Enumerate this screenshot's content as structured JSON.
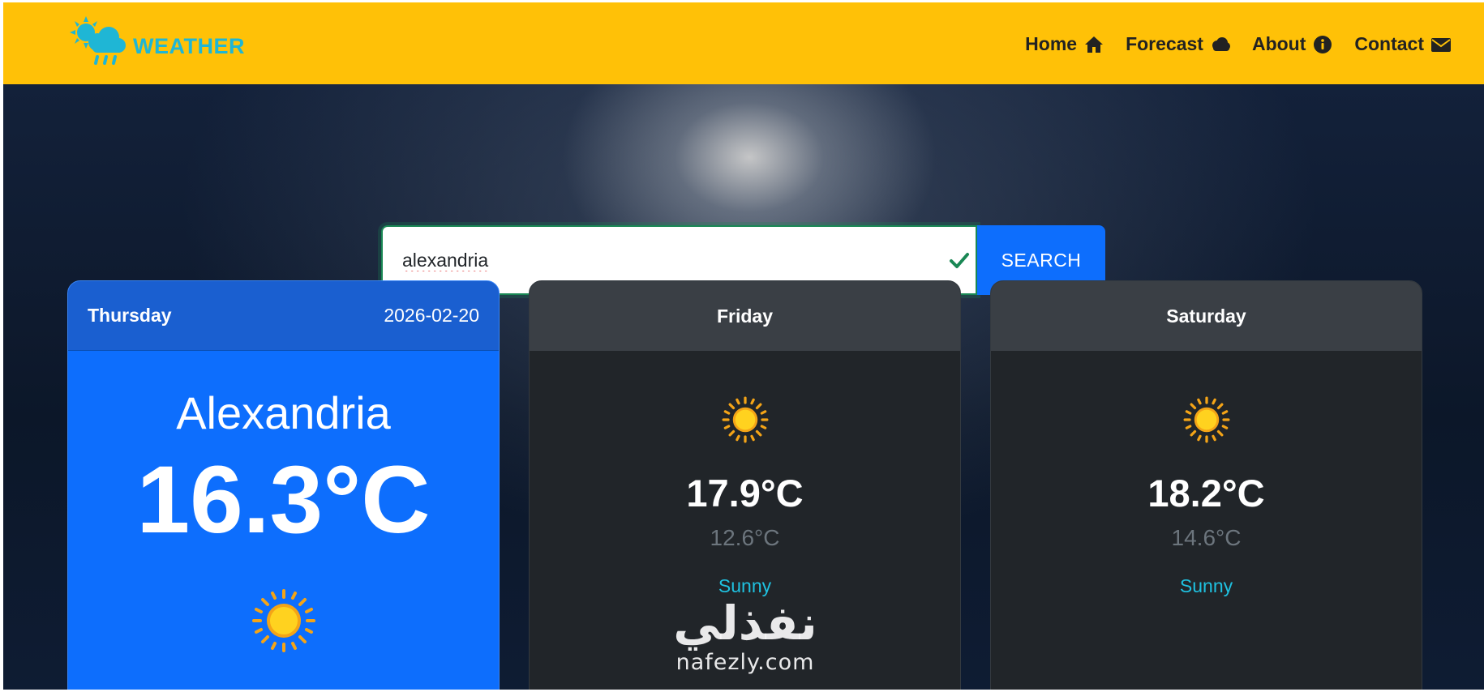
{
  "brand": {
    "name": "WEATHER",
    "icon": "weather-logo-icon",
    "color": "#1fb6d5"
  },
  "nav": {
    "background": "#ffc107",
    "items": [
      {
        "label": "Home",
        "icon": "home-icon"
      },
      {
        "label": "Forecast",
        "icon": "cloud-icon"
      },
      {
        "label": "About",
        "icon": "info-icon"
      },
      {
        "label": "Contact",
        "icon": "envelope-icon"
      }
    ]
  },
  "search": {
    "value": "alexandria",
    "button_label": "SEARCH",
    "valid_icon": "check-icon"
  },
  "today": {
    "day": "Thursday",
    "date": "2026-02-20",
    "city": "Alexandria",
    "temp": "16.3°C",
    "icon": "sun-icon"
  },
  "forecast": [
    {
      "day": "Friday",
      "max": "17.9°C",
      "min": "12.6°C",
      "condition": "Sunny",
      "icon": "sun-icon"
    },
    {
      "day": "Saturday",
      "max": "18.2°C",
      "min": "14.6°C",
      "condition": "Sunny",
      "icon": "sun-icon"
    }
  ],
  "watermark": {
    "arabic": "نفذلي",
    "latin": "nafezly.com"
  },
  "colors": {
    "primary": "#0d6efd",
    "card_dark": "#212529",
    "accent_cyan": "#1fc1e0",
    "success": "#198754"
  }
}
